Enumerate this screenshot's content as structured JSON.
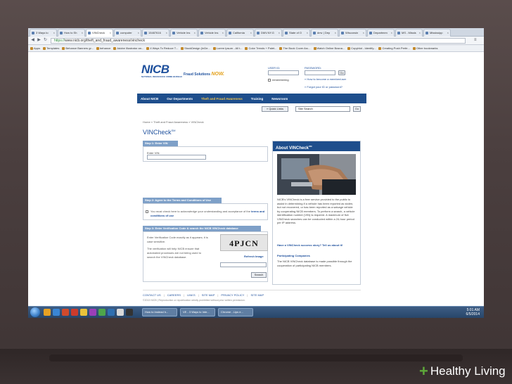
{
  "browser": {
    "tabs": [
      {
        "label": "3 Ways to"
      },
      {
        "label": "How to Sh"
      },
      {
        "label": "VINCheck"
      },
      {
        "label": "computer"
      },
      {
        "label": "15487616"
      },
      {
        "label": "Vehicle Ins"
      },
      {
        "label": "Vehicle Ins"
      },
      {
        "label": "California"
      },
      {
        "label": "DMV.NY.G"
      },
      {
        "label": "State of O"
      },
      {
        "label": "dmv | Dep"
      },
      {
        "label": "Wisconsin"
      },
      {
        "label": "Departmen"
      },
      {
        "label": "MS - Missis"
      },
      {
        "label": "Mississipp"
      }
    ],
    "url_scheme": "https://",
    "url_host": "www.nicb.org",
    "url_path": "/theft_and_fraud_awareness/vincheck",
    "bookmarks": [
      "Apps",
      "Templates",
      "Behance Banners gr...",
      "behance",
      "Adobe Illustrator an...",
      "4 Ways To Reduce T...",
      "StockDesign (InDe...",
      "Lorem Ipsum - All t...",
      "Color Trends + Palet...",
      "The Book Cover Arc...",
      "Watch Online Bosna...",
      "Copyblot - Identify...",
      "Creating Posh Perfe...",
      "Other bookmarks"
    ]
  },
  "header": {
    "logo": "NICB",
    "logo_sub": "NATIONAL INSURANCE CRIME BUREAU",
    "tagline": "Fraud Solutions",
    "tagline_accent": "NOW.",
    "user_id_label": "USER ID:",
    "password_label": "PASSWORD:",
    "go_label": "Go",
    "remember_label": "remembering",
    "register_link": "» How to become a member/user",
    "forgot_link": "» Forgot your ID or password?"
  },
  "nav": [
    "About NICB",
    "Our Departments",
    "Theft and Fraud Awareness",
    "Training",
    "Newsroom"
  ],
  "tools": {
    "quick_links": "» Quick Links",
    "site_search": "Site Search",
    "search_go": "Go"
  },
  "breadcrumb": "Home » Theft and Fraud Awareness » VINCheck",
  "page_title": "VINCheck",
  "page_title_sup": "SM",
  "step1": {
    "header": "Step 1: Enter VIN",
    "label": "Enter VIN:"
  },
  "step2": {
    "header": "Step 2: Agree to the Terms and Conditions of Use",
    "text": "You must check here to acknowledge your understanding and acceptance of the ",
    "link": "terms and conditions of use"
  },
  "step3": {
    "header": "Step 3: Enter Verification Code & search the NICB VINCheck database",
    "text1": "Enter Verification Code exactly as it appears; it is case sensitive.",
    "text2": "The verification will help NICB ensure that automated processes are not being used to search the VINCheck database.",
    "captcha": "4PJCN",
    "refresh": "Refresh Image",
    "search": "Search"
  },
  "about": {
    "title": "About VINCheck",
    "title_sup": "SM",
    "text": "NICB's VINCheck is a free service provided to the public to assist in determining if a vehicle has been reported as stolen, but not recovered, or has been reported as a salvage vehicle by cooperating NICB members. To perform a search, a vehicle identification number (VIN) is required. A maximum of five VINCheck searches can be conducted within a 24-hour period per IP address.",
    "success_link": "Have a VINCheck success story? Tell us about it!",
    "companies_title": "Participating Companies",
    "companies_text": "The NICB VINCheck database is made possible through the cooperation of participating NICB members."
  },
  "footer": {
    "links": [
      "CONTACT US",
      "CAREERS",
      "LINKS",
      "SITE MAP",
      "PRIVACY POLICY",
      "SITE MAP"
    ],
    "copyright": "©2013 NICB | Reproduction or republication strictly prohibited without prior written permission."
  },
  "taskbar": {
    "windows": [
      "How to Instead h...",
      "VE - 3 Ways to Inte...",
      "Chrome - Lips e..."
    ],
    "time": "5:01 AM",
    "date": "6/5/2014"
  },
  "brand": {
    "mark": "+",
    "name": "Healthy Living"
  },
  "colors": {
    "nicb_blue": "#1d4f9c",
    "nav_bar": "#1e4e8c",
    "step_bar": "#7ea0c8",
    "accent": "#e3a11b",
    "brand_green": "#5ea83a"
  }
}
